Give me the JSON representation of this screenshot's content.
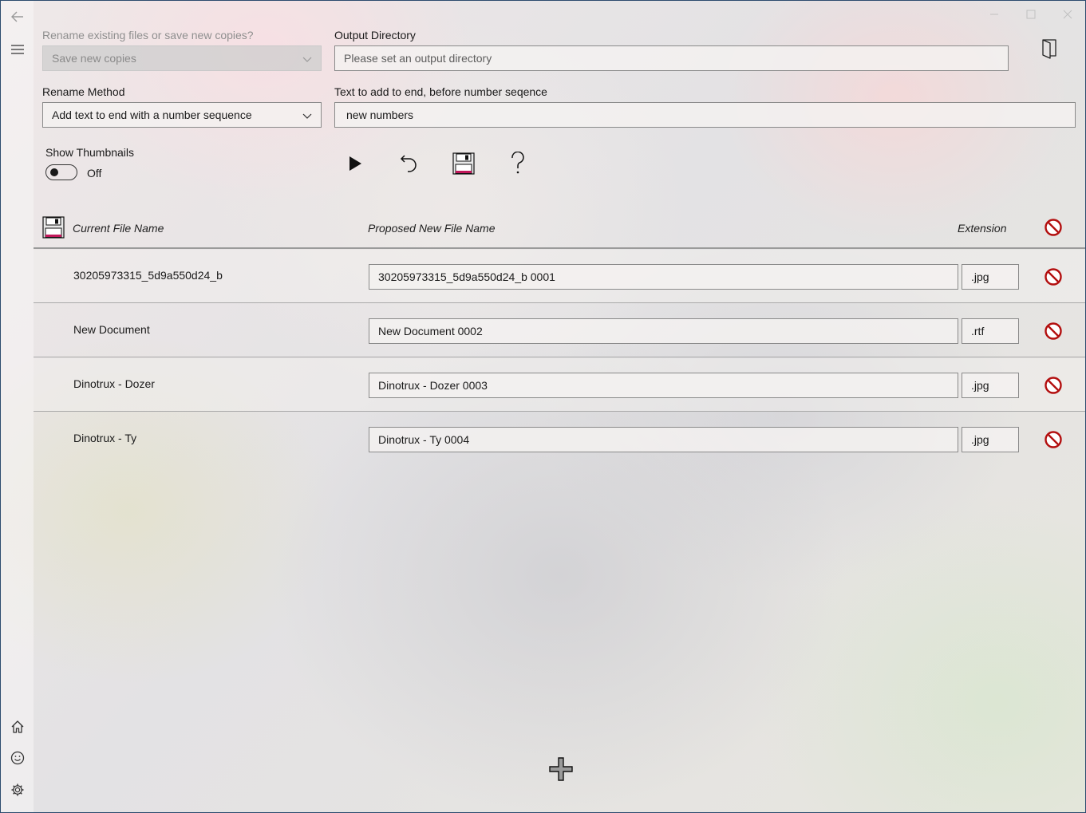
{
  "window": {
    "caption": {
      "minimize_icon": "minimize-icon",
      "maximize_icon": "maximize-icon",
      "close_icon": "close-icon"
    }
  },
  "nav": {
    "back_icon": "back-arrow-icon",
    "menu_icon": "hamburger-icon",
    "bottom_icons": [
      "home-icon",
      "smiley-icon",
      "gear-icon"
    ]
  },
  "form": {
    "mode_label": "Rename existing files or save new copies?",
    "mode_value": "Save new copies",
    "output_label": "Output Directory",
    "output_placeholder": "Please set an output directory",
    "method_label": "Rename Method",
    "method_value": "Add text to end with a number sequence",
    "text_label": "Text to add to end, before number seqence",
    "text_value": "new numbers",
    "thumbs_label": "Show Thumbnails",
    "thumbs_state": "Off"
  },
  "toolbar": [
    "play-icon",
    "undo-icon",
    "save-icon",
    "help-icon"
  ],
  "table": {
    "headers": {
      "current": "Current File Name",
      "proposed": "Proposed New File Name",
      "extension": "Extension"
    },
    "rows": [
      {
        "current": "30205973315_5d9a550d24_b",
        "proposed": "30205973315_5d9a550d24_b 0001",
        "ext": ".jpg"
      },
      {
        "current": "New Document",
        "proposed": "New Document 0002",
        "ext": ".rtf"
      },
      {
        "current": "Dinotrux - Dozer",
        "proposed": "Dinotrux - Dozer 0003",
        "ext": ".jpg"
      },
      {
        "current": "Dinotrux - Ty",
        "proposed": "Dinotrux - Ty 0004",
        "ext": ".jpg"
      }
    ]
  },
  "colors": {
    "delete_red": "#b30f0f",
    "disk_pink": "#c2185b"
  }
}
